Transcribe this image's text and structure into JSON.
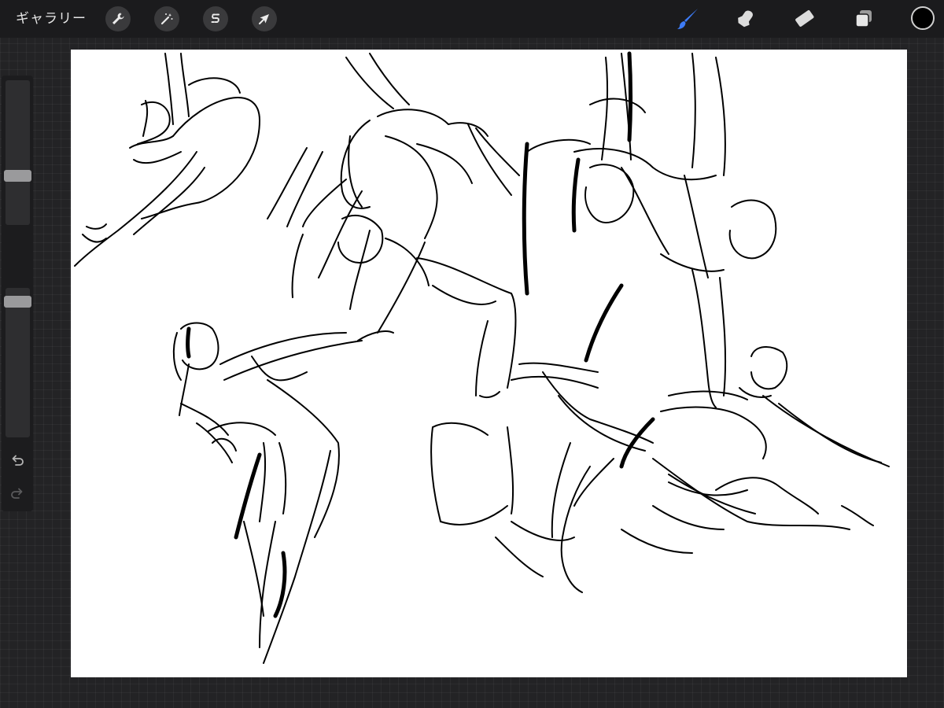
{
  "app": {
    "gallery_label": "ギャラリー"
  },
  "toolbar": {
    "actions": [
      {
        "name": "actions",
        "icon": "wrench-icon"
      },
      {
        "name": "adjustments",
        "icon": "magic-wand-icon"
      },
      {
        "name": "selection",
        "icon": "selection-s-icon"
      },
      {
        "name": "transform",
        "icon": "arrow-cursor-icon"
      }
    ],
    "paint_tools": [
      {
        "name": "brush",
        "icon": "brush-icon",
        "active": true
      },
      {
        "name": "smudge",
        "icon": "smudge-finger-icon",
        "active": false
      },
      {
        "name": "eraser",
        "icon": "eraser-icon",
        "active": false
      },
      {
        "name": "layers",
        "icon": "layers-icon",
        "active": false
      }
    ],
    "current_color": "#000000",
    "active_tool_color": "#3d7bf6"
  },
  "sidebar": {
    "brush_size_level": 0.5,
    "opacity_level": 1.0,
    "icons": [
      "square-modify-icon",
      "undo-icon",
      "redo-icon"
    ]
  },
  "canvas": {
    "background": "#ffffff",
    "content": "gesture-sketches"
  }
}
